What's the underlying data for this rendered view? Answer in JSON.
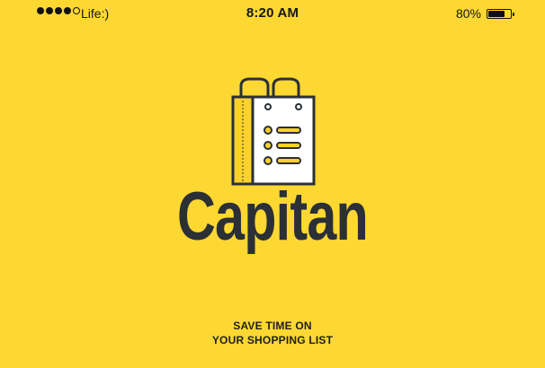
{
  "status_bar": {
    "signal_filled": 4,
    "signal_total": 5,
    "carrier": "Life:)",
    "time": "8:20 AM",
    "battery_percent_text": "80%",
    "battery_level": 0.8
  },
  "logo": {
    "icon": "shopping-bag-list-icon",
    "colors": {
      "background": "#FDD832",
      "stroke": "#2b2f36",
      "bag_face": "#FFFFFF",
      "bag_side": "#FBD22B"
    }
  },
  "app": {
    "name": "Capitan",
    "tagline_line1": "SAVE TIME ON",
    "tagline_line2": "YOUR SHOPPING LIST"
  }
}
